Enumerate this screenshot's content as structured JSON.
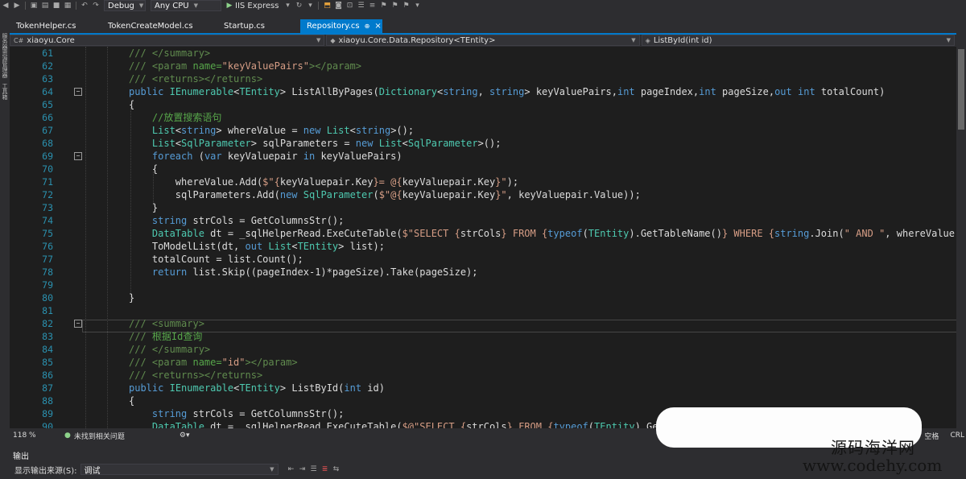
{
  "toolbar": {
    "config": "Debug",
    "platform": "Any CPU",
    "run_label": "IIS Express"
  },
  "tabs": [
    {
      "label": "TokenHelper.cs"
    },
    {
      "label": "TokenCreateModel.cs"
    },
    {
      "label": "Startup.cs"
    },
    {
      "label": "Repository.cs"
    }
  ],
  "side_labels": [
    "服务器资源管理器",
    "工具箱"
  ],
  "nav": {
    "project": "xiaoyu.Core",
    "type": "xiaoyu.Core.Data.Repository<TEntity>",
    "member": "ListById(int id)"
  },
  "code": {
    "numbers": [
      "61",
      "62",
      "63",
      "64",
      "65",
      "66",
      "67",
      "68",
      "69",
      "70",
      "71",
      "72",
      "73",
      "74",
      "75",
      "76",
      "77",
      "78",
      "79",
      "80",
      "81",
      "82",
      "83",
      "84",
      "85",
      "86",
      "87",
      "88",
      "89",
      "90"
    ]
  },
  "status": {
    "zoom": "118 %",
    "issues": "未找到相关问题",
    "right_a": "空格",
    "right_b": "CRL"
  },
  "output": {
    "title": "输出",
    "source_label": "显示输出来源(S):",
    "source_value": "调试"
  },
  "watermark": {
    "line1": "源码海洋网",
    "line2": "www.codehy.com"
  }
}
